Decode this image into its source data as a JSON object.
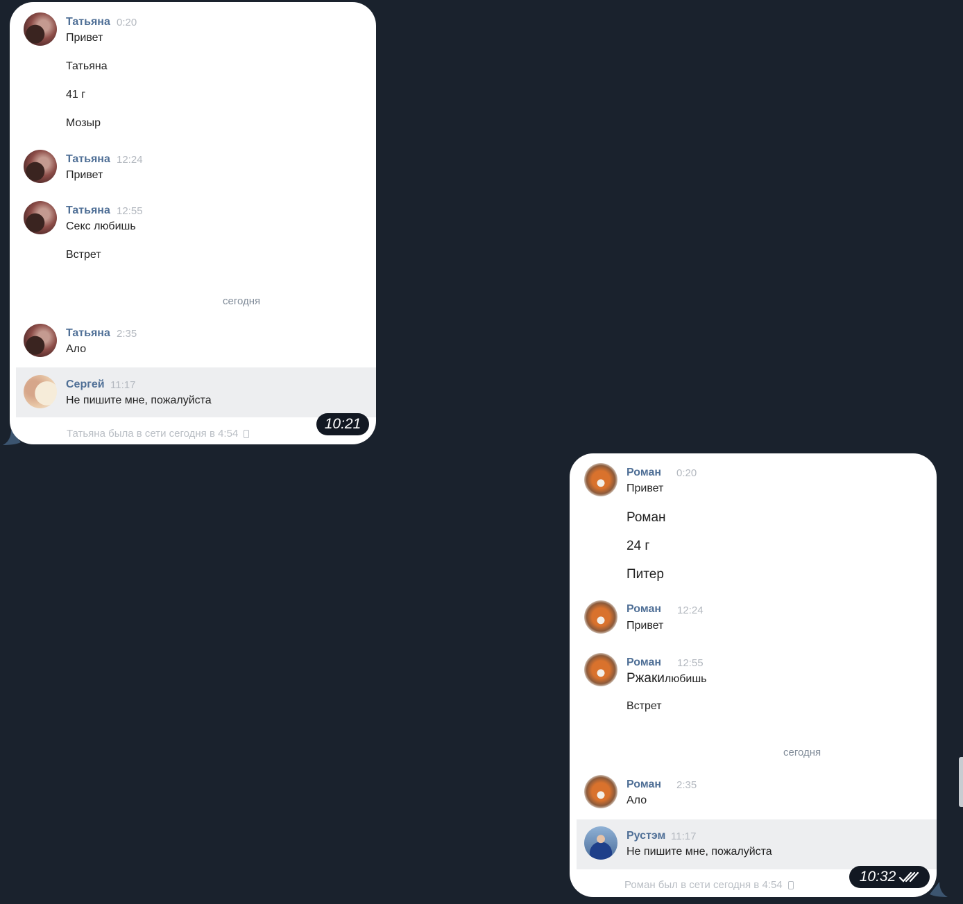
{
  "left": {
    "messages": [
      {
        "name": "Татьяна",
        "time": "0:20",
        "lines": [
          "Привет",
          "Татьяна",
          "41 г",
          "Мозыр"
        ]
      },
      {
        "name": "Татьяна",
        "time": "12:24",
        "lines": [
          "Привет"
        ]
      },
      {
        "name": "Татьяна",
        "time": "12:55",
        "lines": [
          "Секс любишь",
          "Встрет"
        ]
      },
      {
        "name": "Татьяна",
        "time": "2:35",
        "lines": [
          "Ало"
        ]
      },
      {
        "name": "Сергей",
        "time": "11:17",
        "lines": [
          "Не пишите мне, пожалуйста"
        ]
      }
    ],
    "divider": "сегодня",
    "status": "Татьяна была в сети сегодня в 4:54",
    "clock": "10:21"
  },
  "right": {
    "messages": [
      {
        "name": "Роман",
        "time": "0:20",
        "lines": [
          "Привет",
          "Роман",
          "24 г",
          "Питер"
        ]
      },
      {
        "name": "Роман",
        "time": "12:24",
        "lines": [
          "Привет"
        ]
      },
      {
        "name": "Роман",
        "time": "12:55",
        "lines": [
          "Ржаки",
          "любишь",
          "Встрет"
        ]
      },
      {
        "name": "Роман",
        "time": "2:35",
        "lines": [
          "Ало"
        ]
      },
      {
        "name": "Рустэм",
        "time": "11:17",
        "lines": [
          "Не пишите мне, пожалуйста"
        ]
      }
    ],
    "divider": "сегодня",
    "status": "Роман был в сети сегодня в 4:54",
    "clock": "10:32"
  },
  "colors": {
    "background": "#1a222d",
    "name": "#4f6f96",
    "time": "#b3b8bf",
    "highlight": "#edeef0",
    "clock_bg": "#121822"
  },
  "icons": [
    "phone-icon",
    "double-check-icon"
  ]
}
